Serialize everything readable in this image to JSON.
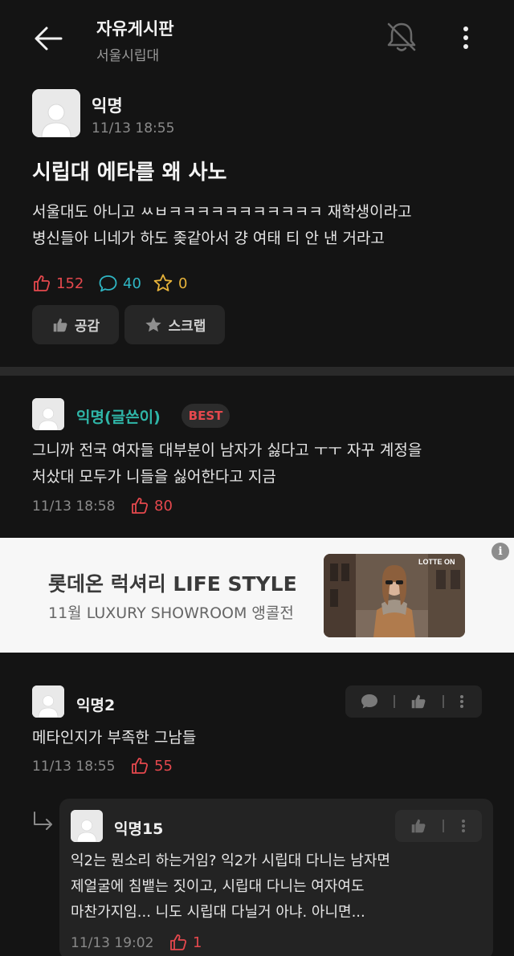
{
  "header": {
    "title": "자유게시판",
    "subtitle": "서울시립대"
  },
  "post": {
    "author": "익명",
    "time": "11/13 18:55",
    "title": "시립대 에타를 왜 사노",
    "body_line1": "서울대도 아니고 ㅆㅂㅋㅋㅋㅋㅋㅋㅋㅋㅋㅋㅋ 재학생이라고",
    "body_line2": "병신들아 니네가 하도 좆같아서 걍 여태 티 안 낸 거라고",
    "likes": "152",
    "comments": "40",
    "scraps": "0",
    "like_button": "공감",
    "scrap_button": "스크랩"
  },
  "comments": [
    {
      "author": "익명(글쓴이)",
      "badge": "BEST",
      "line1": "그니까 전국 여자들 대부분이 남자가 싫다고 ㅜㅜ 자꾸 계정을",
      "line2": "처샀대 모두가 니들을 싫어한다고 지금",
      "time": "11/13 18:58",
      "likes": "80"
    },
    {
      "author": "익명2",
      "line1": "메타인지가 부족한 그남들",
      "time": "11/13 18:55",
      "likes": "55"
    }
  ],
  "reply": {
    "author": "익명15",
    "line1": "익2는 뭔소리 하는거임? 익2가 시립대 다니는 남자면",
    "line2": "제얼굴에 침뱉는 짓이고, 시립대 다니는 여자여도",
    "line3": "마찬가지임... 니도 시립대 다닐거 아냐. 아니면...",
    "time": "11/13 19:02",
    "likes": "1"
  },
  "ad": {
    "title": "롯데온 럭셔리 LIFE STYLE",
    "subtitle": "11월 LUXURY SHOWROOM 앵콜전",
    "logo": "LOTTE ON",
    "info": "i"
  },
  "colors": {
    "background": "#141414",
    "like_red": "#e5484d",
    "comment_teal": "#2fb6c4",
    "scrap_yellow": "#e6b23a",
    "author_teal": "#2fb6a8"
  },
  "icons": [
    "back-arrow-icon",
    "bell-off-icon",
    "more-vertical-icon",
    "thumb-up-icon",
    "comment-bubble-icon",
    "star-icon",
    "reply-arrow-icon",
    "info-icon"
  ]
}
